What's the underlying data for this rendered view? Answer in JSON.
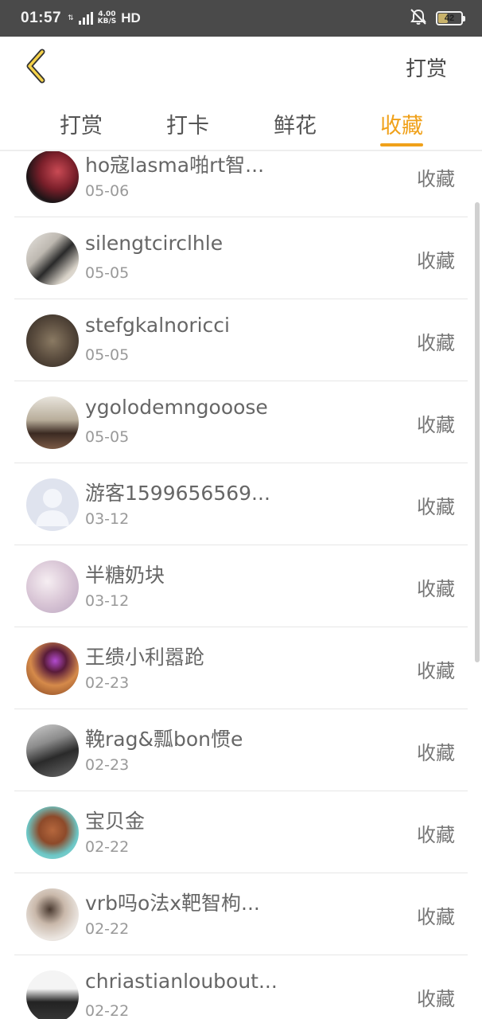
{
  "status_bar": {
    "time": "01:57",
    "network": "4G",
    "speed_top": "4.00",
    "speed_bottom": "KB/S",
    "hd": "HD",
    "battery_level": "42",
    "battery_fraction": 0.42
  },
  "header": {
    "back_icon": "chevron-left-icon",
    "title": "打赏",
    "accent_color": "#f0a11a"
  },
  "tabs": [
    {
      "label": "打赏",
      "active": false
    },
    {
      "label": "打卡",
      "active": false
    },
    {
      "label": "鲜花",
      "active": false
    },
    {
      "label": "收藏",
      "active": true
    }
  ],
  "list": [
    {
      "name": "ho寇lasma啪rt智...",
      "date": "05-06",
      "action": "收藏"
    },
    {
      "name": "silengtcirclhle",
      "date": "05-05",
      "action": "收藏"
    },
    {
      "name": "stefgkalnoricci",
      "date": "05-05",
      "action": "收藏"
    },
    {
      "name": "ygolodemngooose",
      "date": "05-05",
      "action": "收藏"
    },
    {
      "name": "游客1599656569...",
      "date": "03-12",
      "action": "收藏"
    },
    {
      "name": "半糖奶块",
      "date": "03-12",
      "action": "收藏"
    },
    {
      "name": "王缋小利嚣跄",
      "date": "02-23",
      "action": "收藏"
    },
    {
      "name": "鞔rag&瓢bon惯e",
      "date": "02-23",
      "action": "收藏"
    },
    {
      "name": "宝贝金",
      "date": "02-22",
      "action": "收藏"
    },
    {
      "name": "vrb吗o法x靶智枸...",
      "date": "02-22",
      "action": "收藏"
    },
    {
      "name": "chriastianloubout...",
      "date": "02-22",
      "action": "收藏"
    }
  ]
}
